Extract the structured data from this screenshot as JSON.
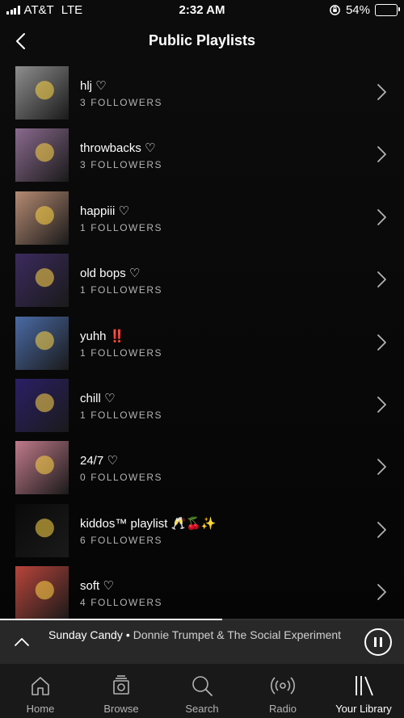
{
  "status": {
    "carrier": "AT&T",
    "network": "LTE",
    "time": "2:32 AM",
    "battery": "54%",
    "battery_level": 0.54
  },
  "header": {
    "title": "Public Playlists"
  },
  "playlists": [
    {
      "name": "hlj ♡",
      "count": "3",
      "followers_label": "FOLLOWERS",
      "thumb": "#8e8e8e"
    },
    {
      "name": "throwbacks ♡",
      "count": "3",
      "followers_label": "FOLLOWERS",
      "thumb": "#8a6a8e"
    },
    {
      "name": "happiii ♡",
      "count": "1",
      "followers_label": "FOLLOWERS",
      "thumb": "#b58a72"
    },
    {
      "name": "old bops ♡",
      "count": "1",
      "followers_label": "FOLLOWERS",
      "thumb": "#3b2a5e"
    },
    {
      "name": "yuhh ‼️",
      "count": "1",
      "followers_label": "FOLLOWERS",
      "thumb": "#4a6aa6"
    },
    {
      "name": "chill ♡",
      "count": "1",
      "followers_label": "FOLLOWERS",
      "thumb": "#2a1f66"
    },
    {
      "name": "24/7 ♡",
      "count": "0",
      "followers_label": "FOLLOWERS",
      "thumb": "#c07a8a"
    },
    {
      "name": "kiddos™ playlist 🥂🍒✨",
      "count": "6",
      "followers_label": "FOLLOWERS",
      "thumb": "#0a0a0a"
    },
    {
      "name": "soft ♡",
      "count": "4",
      "followers_label": "FOLLOWERS",
      "thumb": "#b8443a"
    }
  ],
  "now_playing": {
    "track": "Sunday Candy",
    "artist": "Donnie Trumpet & The Social Experiment",
    "progress": 0.55
  },
  "tabs": [
    {
      "label": "Home",
      "icon": "home-icon"
    },
    {
      "label": "Browse",
      "icon": "browse-icon"
    },
    {
      "label": "Search",
      "icon": "search-icon"
    },
    {
      "label": "Radio",
      "icon": "radio-icon"
    },
    {
      "label": "Your Library",
      "icon": "library-icon",
      "active": true
    }
  ]
}
